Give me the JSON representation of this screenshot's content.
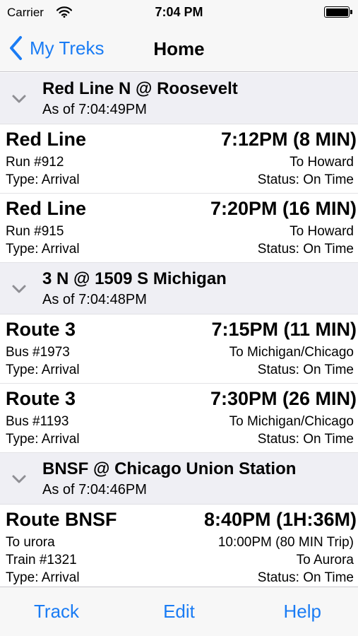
{
  "status_bar": {
    "carrier": "Carrier",
    "time": "7:04 PM"
  },
  "nav": {
    "back_label": "My Treks",
    "title": "Home"
  },
  "sections": [
    {
      "title": "Red Line N @ Roosevelt",
      "as_of": "As of 7:04:49PM",
      "rows": [
        {
          "name": "Red Line",
          "eta": "7:12PM (8 MIN)",
          "left": [
            "Run #912",
            "Type: Arrival"
          ],
          "right": [
            "To Howard",
            "Status: On Time"
          ]
        },
        {
          "name": "Red Line",
          "eta": "7:20PM (16 MIN)",
          "left": [
            "Run #915",
            "Type: Arrival"
          ],
          "right": [
            "To Howard",
            "Status: On Time"
          ]
        }
      ]
    },
    {
      "title": "3 N @ 1509 S Michigan",
      "as_of": "As of 7:04:48PM",
      "rows": [
        {
          "name": "Route 3",
          "eta": "7:15PM (11 MIN)",
          "left": [
            "Bus #1973",
            "Type: Arrival"
          ],
          "right": [
            "To Michigan/Chicago",
            "Status: On Time"
          ]
        },
        {
          "name": "Route 3",
          "eta": "7:30PM (26 MIN)",
          "left": [
            "Bus #1193",
            "Type: Arrival"
          ],
          "right": [
            "To Michigan/Chicago",
            "Status: On Time"
          ]
        }
      ]
    },
    {
      "title": "BNSF @ Chicago Union Station",
      "as_of": "As of 7:04:46PM",
      "rows": [
        {
          "name": "Route BNSF",
          "eta": "8:40PM (1H:36M)",
          "left": [
            "To urora",
            "Train #1321",
            "Type: Arrival"
          ],
          "right": [
            "10:00PM (80 MIN Trip)",
            "To Aurora",
            "Status: On Time"
          ]
        }
      ]
    }
  ],
  "tab_bar": {
    "track": "Track",
    "edit": "Edit",
    "help": "Help"
  },
  "colors": {
    "accent": "#1a7cf4",
    "section_bg": "#efeff4",
    "bar_bg": "#f7f7f7"
  },
  "icons": {
    "back": "chevron-left-icon",
    "section": "chevron-down-icon",
    "wifi": "wifi-icon",
    "battery": "battery-icon"
  }
}
